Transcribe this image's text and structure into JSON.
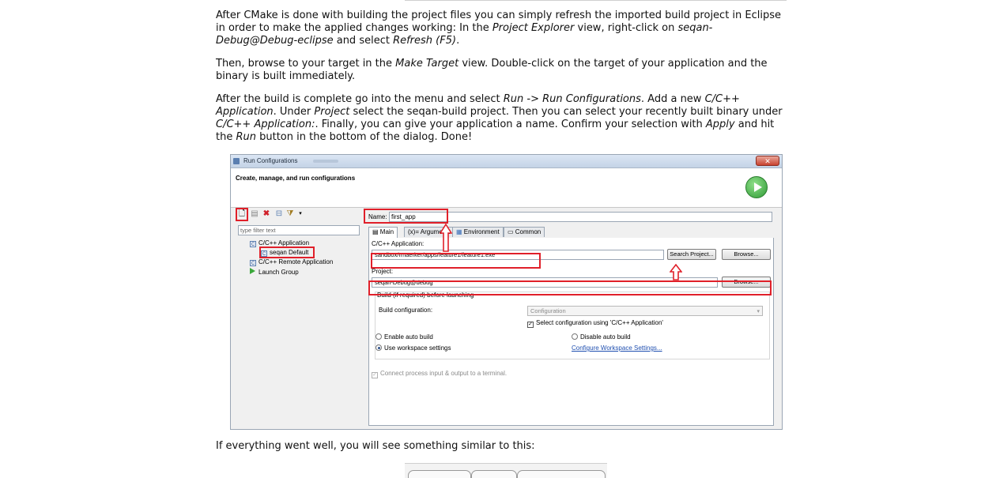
{
  "prose": {
    "p1": [
      {
        "t": "After CMake is done with building the project files you can simply refresh the imported build project in Eclipse in order to make the applied changes working: In the "
      },
      {
        "t": "Project Explorer",
        "i": true
      },
      {
        "t": " view, right-click on "
      },
      {
        "t": "seqan-Debug@Debug-eclipse",
        "i": true
      },
      {
        "t": " and select "
      },
      {
        "t": "Refresh (F5)",
        "i": true
      },
      {
        "t": "."
      }
    ],
    "p2": [
      {
        "t": "Then, browse to your target in the "
      },
      {
        "t": "Make Target",
        "i": true
      },
      {
        "t": " view. Double-click on the target of your application and the binary is built immediately."
      }
    ],
    "p3": [
      {
        "t": "After the build is complete go into the menu and select "
      },
      {
        "t": "Run -> Run Configurations",
        "i": true
      },
      {
        "t": ". Add a new "
      },
      {
        "t": "C/C++ Application",
        "i": true
      },
      {
        "t": ". Under "
      },
      {
        "t": "Project",
        "i": true
      },
      {
        "t": " select the seqan-build project. Then you can select your recently built binary under "
      },
      {
        "t": "C/C++ Application:",
        "i": true
      },
      {
        "t": ". Finally, you can give your application a name. Confirm your selection with "
      },
      {
        "t": "Apply",
        "i": true
      },
      {
        "t": " and hit the "
      },
      {
        "t": "Run",
        "i": true
      },
      {
        "t": " button in the bottom of the dialog. Done!"
      }
    ],
    "p4": [
      {
        "t": "If everything went well, you will see something similar to this:"
      }
    ]
  },
  "dialog": {
    "title": "Run Configurations",
    "close_glyph": "✕",
    "header_title": "Create, manage, and run configurations",
    "filter_placeholder": "type filter text",
    "tree": {
      "c_app": "C/C++ Application",
      "seqan_default": "seqan Default",
      "c_remote": "C/C++ Remote Application",
      "launch_group": "Launch Group"
    },
    "name_label": "Name:",
    "name_value": "first_app",
    "tabs": {
      "main": "Main",
      "arguments": "Arguments",
      "environment": "Environment",
      "common": "Common"
    },
    "app_label": "C/C++ Application:",
    "app_value": "sandbox/rmaerker/apps/feature1/feature1.exe",
    "search_project": "Search Project...",
    "browse": "Browse...",
    "project_label": "Project:",
    "project_value": "seqan-Debug@debug",
    "build_group_label": "Build (if required) before launching",
    "build_config_label": "Build configuration:",
    "build_config_value": "Configuration",
    "select_config_label": "Select configuration using 'C/C++ Application'",
    "enable_auto_build": "Enable auto build",
    "disable_auto_build": "Disable auto build",
    "use_workspace": "Use workspace settings",
    "configure_workspace": "Configure Workspace Settings...",
    "connect_process": "Connect process input & output to a terminal.",
    "icons": {
      "new": "new-config-icon",
      "dup": "duplicate-icon",
      "del": "delete-icon",
      "collapse": "collapse-icon",
      "filter": "filter-icon"
    },
    "colors": {
      "highlight": "#e0202a",
      "run": "#2f9a35"
    }
  }
}
